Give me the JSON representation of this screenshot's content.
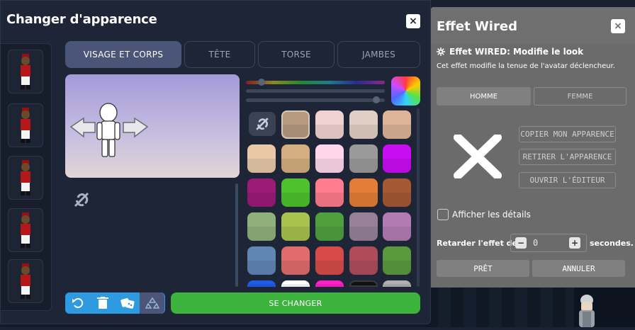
{
  "left_window": {
    "title": "Changer d'apparence",
    "close_icon": "×",
    "tabs": [
      "VISAGE ET CORPS",
      "TÊTE",
      "TORSE",
      "JAMBES"
    ],
    "palette": [
      [
        "#b59a7f",
        "#f0d2d2",
        "#e0cfc4",
        "#dcb497"
      ],
      [
        "#e8c8a6",
        "#d4ad80",
        "#ffd6ec",
        "#9a9a9a",
        "#c90df2"
      ],
      [
        "#9b1b76",
        "#4ec22c",
        "#ff7b8d",
        "#e37d38",
        "#a55834"
      ],
      [
        "#8fb07a",
        "#a7c24e",
        "#4f9f3f",
        "#968199",
        "#b27cb3"
      ],
      [
        "#5f86b5",
        "#e06c6c",
        "#d64a4a",
        "#ae4c5c",
        "#599a3f"
      ],
      [
        "#1f5de8",
        "#ffffff",
        "#ff1fc7",
        "#111111",
        "#b0b0b0"
      ]
    ],
    "change_button": "SE CHANGER"
  },
  "right_panel": {
    "title": "Effet Wired",
    "close_icon": "×",
    "effect_name": "Effet WIRED: Modifie le look",
    "effect_desc": "Cet effet modifie la tenue de l'avatar déclencheur.",
    "gender_tabs": [
      "HOMME",
      "FEMME"
    ],
    "actions": [
      "COPIER MON APPARENCE",
      "RETIRER L'APPARENCE",
      "OUVRIR L'ÉDITEUR"
    ],
    "show_details": "Afficher les détails",
    "delay_label": "Retarder l'effet de:",
    "delay_value": "0",
    "delay_unit": "secondes.",
    "minus": "−",
    "plus": "+",
    "ok_button": "PRÊT",
    "cancel_button": "ANNULER"
  },
  "icons": {
    "undo": "undo-icon",
    "trash": "trash-icon",
    "dice": "dice-icon",
    "recycle": "recycle-icon",
    "no_link": "no-link-icon",
    "gear": "gear-icon",
    "big_x": "x-mark-icon"
  }
}
